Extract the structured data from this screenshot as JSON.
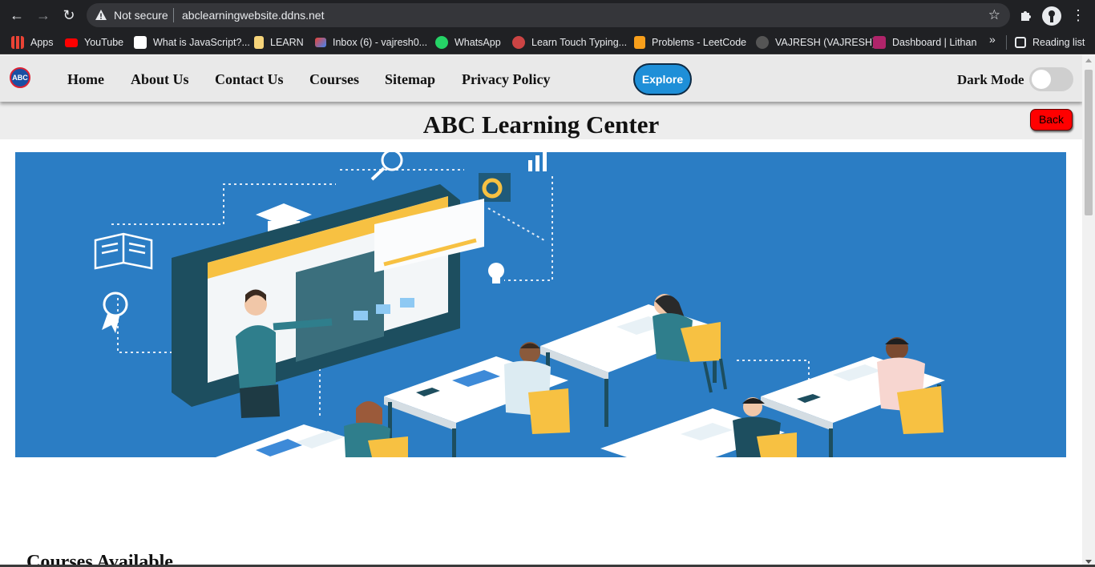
{
  "browser": {
    "security_label": "Not secure",
    "url": "abclearningwebsite.ddns.net",
    "bookmarks": [
      {
        "label": "Apps",
        "icon": "apps-grid-icon",
        "color": "#4285f4"
      },
      {
        "label": "YouTube",
        "icon": "youtube-icon",
        "color": "#ff0000"
      },
      {
        "label": "What is JavaScript?...",
        "icon": "javascript-site-icon",
        "color": "#ffffff"
      },
      {
        "label": "LEARN",
        "icon": "folder-icon",
        "color": "#f6d47a"
      },
      {
        "label": "Inbox (6) - vajresh0...",
        "icon": "gmail-icon",
        "color": "#ea4335"
      },
      {
        "label": "WhatsApp",
        "icon": "whatsapp-icon",
        "color": "#25d366"
      },
      {
        "label": "Learn Touch Typing...",
        "icon": "typing-site-icon",
        "color": "#c44"
      },
      {
        "label": "Problems - LeetCode",
        "icon": "leetcode-icon",
        "color": "#f89f1b"
      },
      {
        "label": "VAJRESH (VAJRESH)",
        "icon": "github-icon",
        "color": "#555555"
      },
      {
        "label": "Dashboard | Lithan",
        "icon": "lithan-icon",
        "color": "#b0246a"
      }
    ],
    "reading_list": "Reading list"
  },
  "site": {
    "nav": {
      "logo_text": "ABC",
      "links": [
        "Home",
        "About Us",
        "Contact Us",
        "Courses",
        "Sitemap",
        "Privacy Policy"
      ],
      "explore_label": "Explore",
      "dark_mode_label": "Dark Mode",
      "dark_mode_on": false
    },
    "title": "ABC Learning Center",
    "back_label": "Back",
    "hero": {
      "background": "#2b7dc4",
      "accent": "#f7c142"
    },
    "section_heading": "Courses Available"
  }
}
